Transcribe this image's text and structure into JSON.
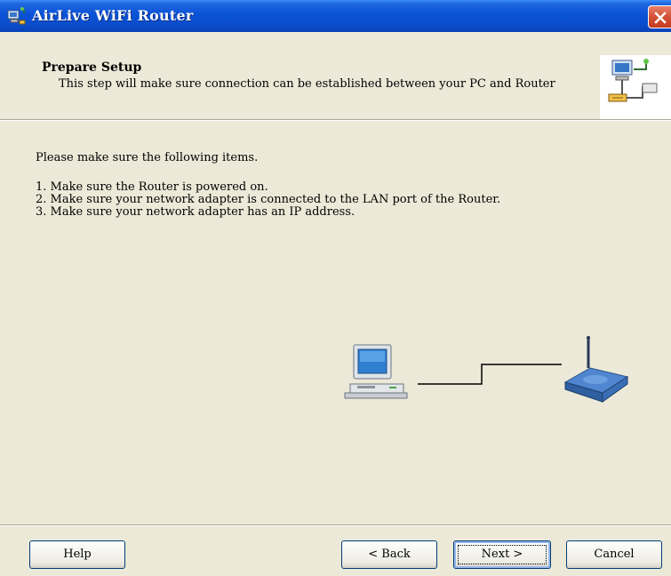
{
  "window": {
    "title": "AirLive WiFi Router"
  },
  "header": {
    "title": "Prepare Setup",
    "subtitle": "This step will make sure connection can be established between your PC and Router",
    "icon": "network-setup-icon"
  },
  "body": {
    "intro": "Please make sure the following items.",
    "steps": [
      "1. Make sure the Router is powered on.",
      "2. Make sure your network adapter is connected to the LAN port of the Router.",
      "3. Make sure your network adapter has an IP address."
    ],
    "diagram": {
      "left_icon": "computer-icon",
      "right_icon": "wireless-router-icon"
    }
  },
  "buttons": {
    "help": "Help",
    "back": "< Back",
    "next": "Next >",
    "cancel": "Cancel"
  },
  "colors": {
    "titlebar": "#0a52d6",
    "close": "#d6543a",
    "background": "#ece9d8"
  }
}
